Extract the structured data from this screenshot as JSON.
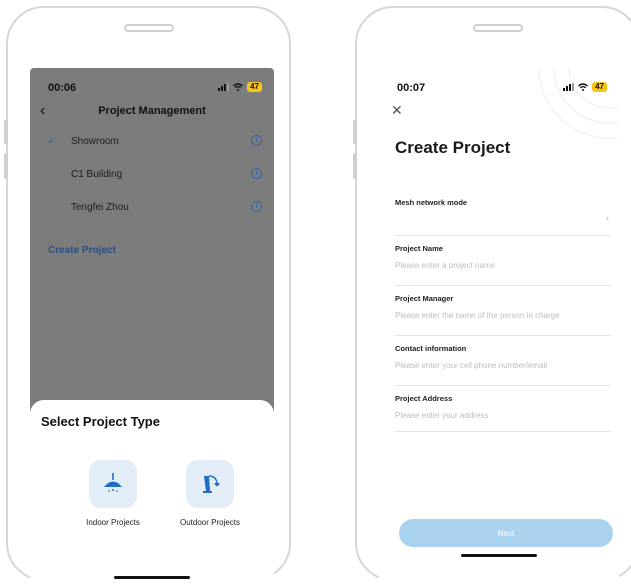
{
  "left_screen": {
    "status": {
      "time": "00:06",
      "battery": "47"
    },
    "nav": {
      "title": "Project Management"
    },
    "projects": [
      {
        "name": "Showroom",
        "selected": true
      },
      {
        "name": "C1 Building",
        "selected": false
      },
      {
        "name": "Tengfei Zhou",
        "selected": false
      }
    ],
    "create_project_link": "Create Project",
    "sheet": {
      "title": "Select Project Type",
      "options": [
        {
          "label": "Indoor Projects",
          "icon": "ceiling-lamp-icon"
        },
        {
          "label": "Outdoor Projects",
          "icon": "street-lamp-icon"
        }
      ]
    }
  },
  "right_screen": {
    "status": {
      "time": "00:07",
      "battery": "47"
    },
    "title": "Create Project",
    "fields": {
      "mesh": {
        "label": "Mesh network mode",
        "value": ""
      },
      "name": {
        "label": "Project Name",
        "placeholder": "Please enter a project name"
      },
      "manager": {
        "label": "Project Manager",
        "placeholder": "Please enter the name of the person in charge"
      },
      "contact": {
        "label": "Contact information",
        "placeholder": "Please enter your cell phone number/email"
      },
      "address": {
        "label": "Project Address",
        "placeholder": "Please enter your address"
      }
    },
    "next_button": "Next"
  },
  "colors": {
    "accent_blue": "#3566ad",
    "dim_overlay": "#7c7c7c",
    "tile_bg": "#e3edf8",
    "next_button_disabled": "#a9d2ee",
    "battery": "#f5c518"
  }
}
